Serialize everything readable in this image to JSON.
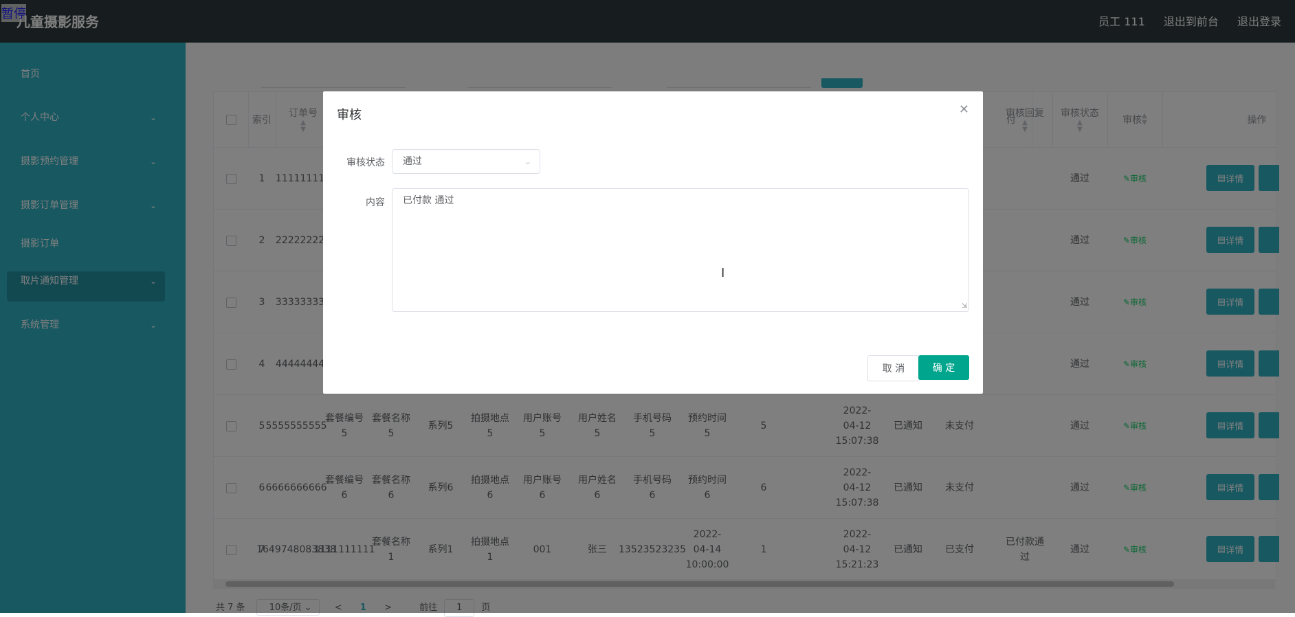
{
  "app": {
    "title": "儿童摄影服务",
    "overlay_text": "暂停"
  },
  "topbar": {
    "user": "员工 111",
    "to_front": "退出到前台",
    "logout": "退出登录"
  },
  "sidebar": {
    "items": [
      {
        "label": "首页"
      },
      {
        "label": "个人中心"
      },
      {
        "label": "摄影预约管理"
      },
      {
        "label": "摄影订单管理"
      },
      {
        "label": "摄影订单"
      },
      {
        "label": "取片通知管理"
      },
      {
        "label": "系统管理"
      }
    ],
    "accent": "#2fb0c3"
  },
  "table": {
    "headers": {
      "index": "索引",
      "order_no": "订单号",
      "pay": "付",
      "reply": "审核回复",
      "status": "审核状态",
      "audit": "审核",
      "ops": "操作"
    },
    "rows": [
      {
        "index": "1",
        "order_no": "111111111",
        "status": "通过",
        "audit": "审核",
        "detail": "详情"
      },
      {
        "index": "2",
        "order_no": "222222222",
        "status": "通过",
        "audit": "审核",
        "detail": "详情"
      },
      {
        "index": "3",
        "order_no": "333333333",
        "status": "通过",
        "audit": "审核",
        "detail": "详情"
      },
      {
        "index": "4",
        "order_no": "444444444",
        "status": "通过",
        "audit": "审核",
        "detail": "详情"
      },
      {
        "index": "5",
        "order_no": "5555555555",
        "pkg_no": "套餐编号5",
        "pkg_name": "套餐名称5",
        "series": "系列5",
        "location": "拍摄地点5",
        "account": "用户账号5",
        "user": "用户姓名5",
        "phone": "手机号码5",
        "appt": "预约时间5",
        "qty": "5",
        "time": "2022-04-12 15:07:38",
        "notify": "已通知",
        "pay": "未支付",
        "reply": "",
        "status": "通过",
        "audit": "审核",
        "detail": "详情"
      },
      {
        "index": "6",
        "order_no": "6666666666",
        "pkg_no": "套餐编号6",
        "pkg_name": "套餐名称6",
        "series": "系列6",
        "location": "拍摄地点6",
        "account": "用户账号6",
        "user": "用户姓名6",
        "phone": "手机号码6",
        "appt": "预约时间6",
        "qty": "6",
        "time": "2022-04-12 15:07:38",
        "notify": "已通知",
        "pay": "未支付",
        "reply": "",
        "status": "通过",
        "audit": "审核",
        "detail": "详情"
      },
      {
        "index": "7",
        "order_no": "1649748083838",
        "pkg_no": "1111111111",
        "pkg_name": "套餐名称1",
        "series": "系列1",
        "location": "拍摄地点1",
        "account": "001",
        "user": "张三",
        "phone": "13523523235",
        "appt": "2022-04-14 10:00:00",
        "qty": "1",
        "time": "2022-04-12 15:21:23",
        "notify": "已通知",
        "pay": "已支付",
        "reply": "已付款通过",
        "status": "通过",
        "audit": "审核",
        "detail": "详情"
      }
    ]
  },
  "pager": {
    "total": "共 7 条",
    "size": "10条/页",
    "prev": "<",
    "page": "1",
    "next": ">",
    "goto": "前往",
    "goto_value": "1",
    "page_suffix": "页"
  },
  "dialog": {
    "title": "审核",
    "status_label": "审核状态",
    "status_value": "通过",
    "content_label": "内容",
    "content_value": "已付款 通过",
    "cancel": "取 消",
    "ok": "确 定"
  }
}
